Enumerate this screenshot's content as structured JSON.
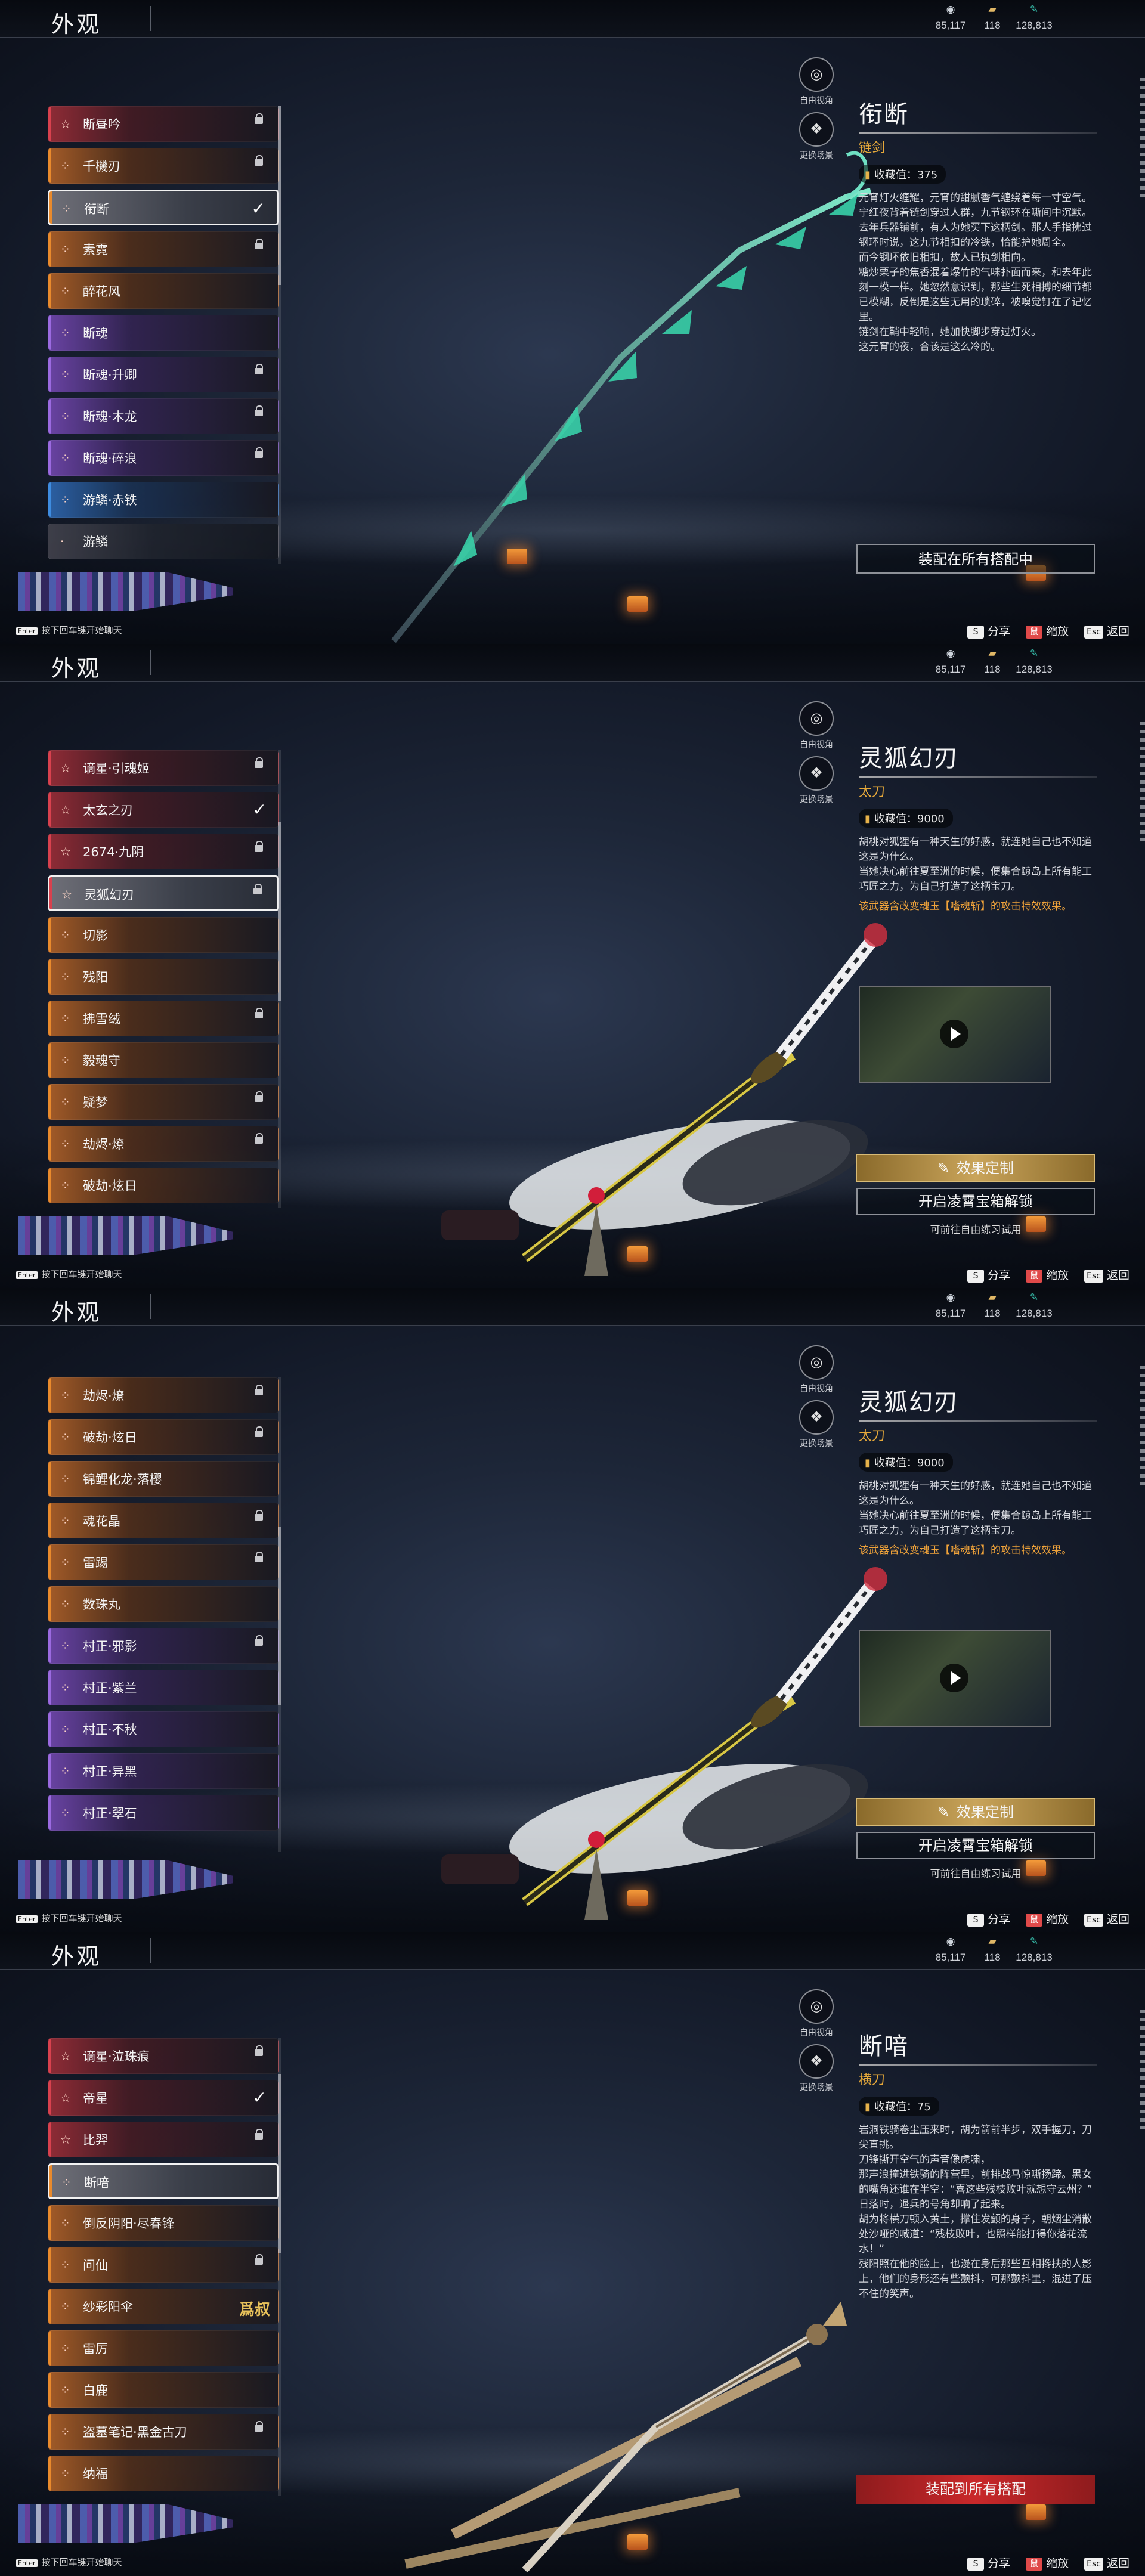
{
  "screens": [
    {
      "title": "外观",
      "currencies": [
        {
          "icon": "coin-icon",
          "value": "85,117"
        },
        {
          "icon": "ticket-icon",
          "value": "118"
        },
        {
          "icon": "jade-feather-icon",
          "value": "128,813"
        }
      ],
      "right_buttons": [
        {
          "icon": "camera-icon",
          "label": "自由视角"
        },
        {
          "icon": "scene-icon",
          "label": "更换场景"
        }
      ],
      "list": [
        {
          "label": "断昼吟",
          "rarity": "red",
          "state": "lock"
        },
        {
          "label": "千機刃",
          "rarity": "orange",
          "state": "lock"
        },
        {
          "label": "衔断",
          "rarity": "orange",
          "state": "check",
          "selected": true
        },
        {
          "label": "素霓",
          "rarity": "orange",
          "state": "lock"
        },
        {
          "label": "醉花风",
          "rarity": "orange",
          "state": ""
        },
        {
          "label": "断魂",
          "rarity": "purple",
          "state": ""
        },
        {
          "label": "断魂·升卿",
          "rarity": "purple",
          "state": "lock"
        },
        {
          "label": "断魂·木龙",
          "rarity": "purple",
          "state": "lock"
        },
        {
          "label": "断魂·碎浪",
          "rarity": "purple",
          "state": "lock"
        },
        {
          "label": "游鳞·赤铁",
          "rarity": "blue",
          "state": ""
        },
        {
          "label": "游鳞",
          "rarity": "plain",
          "state": ""
        }
      ],
      "detail": {
        "name": "衔断",
        "type": "链剑",
        "collection": "收藏值：375",
        "description": "元宵灯火缠耀，元宵的甜腻香气缠绕着每一寸空气。宁红夜背着链剑穿过人群，九节钢环在嘶间中沉默。\n去年兵器铺前，有人为她买下这柄剑。那人手指拂过钢环时说，这九节相扣的冷铁，恰能护她周全。\n而今钢环依旧相扣，故人已执剑相向。\n糖炒栗子的焦香混着爆竹的气味扑面而来，和去年此刻一模一样。她忽然意识到，那些生死相搏的细节都已模糊，反倒是这些无用的琐碎，被嗅觉钉在了记忆里。\n链剑在鞘中轻响，她加快脚步穿过灯火。\n这元宵的夜，合该是这么冷的。",
        "note": "",
        "buttons": [
          {
            "label": "装配在所有搭配中",
            "style": "outline"
          }
        ],
        "hint": ""
      },
      "bottom": {
        "enter_key": "Enter",
        "enter_text": "按下回车键开始聊天",
        "share_key": "S",
        "share": "分享",
        "zoom_key": "鼠",
        "zoom": "缩放",
        "back_key": "Esc",
        "back": "返回"
      }
    },
    {
      "title": "外观",
      "currencies": [
        {
          "icon": "coin-icon",
          "value": "85,117"
        },
        {
          "icon": "ticket-icon",
          "value": "118"
        },
        {
          "icon": "jade-feather-icon",
          "value": "128,813"
        }
      ],
      "right_buttons": [
        {
          "icon": "camera-icon",
          "label": "自由视角"
        },
        {
          "icon": "scene-icon",
          "label": "更换场景"
        }
      ],
      "list": [
        {
          "label": "谪星·引魂姬",
          "rarity": "red",
          "state": "lock"
        },
        {
          "label": "太玄之刃",
          "rarity": "red",
          "state": "check"
        },
        {
          "label": "2674·九阴",
          "rarity": "red",
          "state": "lock"
        },
        {
          "label": "灵狐幻刃",
          "rarity": "red",
          "state": "lock",
          "selected": true
        },
        {
          "label": "切影",
          "rarity": "orange",
          "state": ""
        },
        {
          "label": "残阳",
          "rarity": "orange",
          "state": ""
        },
        {
          "label": "拂雪绒",
          "rarity": "orange",
          "state": "lock"
        },
        {
          "label": "毅魂守",
          "rarity": "orange",
          "state": ""
        },
        {
          "label": "疑梦",
          "rarity": "orange",
          "state": "lock"
        },
        {
          "label": "劫烬·燎",
          "rarity": "orange",
          "state": "lock"
        },
        {
          "label": "破劫·炫日",
          "rarity": "orange",
          "state": ""
        }
      ],
      "detail": {
        "name": "灵狐幻刃",
        "type": "太刀",
        "collection": "收藏值：9000",
        "description": "胡桃对狐狸有一种天生的好感，就连她自己也不知道这是为什么。\n当她决心前往夏至洲的时候，便集合鲸岛上所有能工巧匠之力，为自己打造了这柄宝刀。",
        "note": "该武器含改变魂玉【嗜魂斩】的攻击特效效果。",
        "buttons": [
          {
            "label": "效果定制",
            "style": "gold",
            "icon": "wrench-icon"
          },
          {
            "label": "开启凌霄宝箱解锁",
            "style": "outline"
          }
        ],
        "hint": "可前往自由练习试用"
      },
      "bottom": {
        "enter_key": "Enter",
        "enter_text": "按下回车键开始聊天",
        "share_key": "S",
        "share": "分享",
        "zoom_key": "鼠",
        "zoom": "缩放",
        "back_key": "Esc",
        "back": "返回"
      }
    },
    {
      "title": "外观",
      "currencies": [
        {
          "icon": "coin-icon",
          "value": "85,117"
        },
        {
          "icon": "ticket-icon",
          "value": "118"
        },
        {
          "icon": "jade-feather-icon",
          "value": "128,813"
        }
      ],
      "right_buttons": [
        {
          "icon": "camera-icon",
          "label": "自由视角"
        },
        {
          "icon": "scene-icon",
          "label": "更换场景"
        }
      ],
      "list": [
        {
          "label": "劫烬·燎",
          "rarity": "orange",
          "state": "lock"
        },
        {
          "label": "破劫·炫日",
          "rarity": "orange",
          "state": "lock"
        },
        {
          "label": "锦鲤化龙·落樱",
          "rarity": "orange",
          "state": ""
        },
        {
          "label": "魂花晶",
          "rarity": "orange",
          "state": "lock"
        },
        {
          "label": "雷踢",
          "rarity": "orange",
          "state": "lock"
        },
        {
          "label": "数珠丸",
          "rarity": "orange",
          "state": ""
        },
        {
          "label": "村正·邪影",
          "rarity": "purple",
          "state": "lock"
        },
        {
          "label": "村正·紫兰",
          "rarity": "purple",
          "state": ""
        },
        {
          "label": "村正·不秋",
          "rarity": "purple",
          "state": ""
        },
        {
          "label": "村正·异黑",
          "rarity": "purple",
          "state": ""
        },
        {
          "label": "村正·翠石",
          "rarity": "purple",
          "state": ""
        }
      ],
      "detail": {
        "name": "灵狐幻刃",
        "type": "太刀",
        "collection": "收藏值：9000",
        "description": "胡桃对狐狸有一种天生的好感，就连她自己也不知道这是为什么。\n当她决心前往夏至洲的时候，便集合鲸岛上所有能工巧匠之力，为自己打造了这柄宝刀。",
        "note": "该武器含改变魂玉【嗜魂斩】的攻击特效效果。",
        "buttons": [
          {
            "label": "效果定制",
            "style": "gold",
            "icon": "wrench-icon"
          },
          {
            "label": "开启凌霄宝箱解锁",
            "style": "outline"
          }
        ],
        "hint": "可前往自由练习试用"
      },
      "bottom": {
        "enter_key": "Enter",
        "enter_text": "按下回车键开始聊天",
        "share_key": "S",
        "share": "分享",
        "zoom_key": "鼠",
        "zoom": "缩放",
        "back_key": "Esc",
        "back": "返回"
      }
    },
    {
      "title": "外观",
      "currencies": [
        {
          "icon": "coin-icon",
          "value": "85,117"
        },
        {
          "icon": "ticket-icon",
          "value": "118"
        },
        {
          "icon": "jade-feather-icon",
          "value": "128,813"
        }
      ],
      "right_buttons": [
        {
          "icon": "camera-icon",
          "label": "自由视角"
        },
        {
          "icon": "scene-icon",
          "label": "更换场景"
        }
      ],
      "list": [
        {
          "label": "谪星·泣珠痕",
          "rarity": "red",
          "state": "lock"
        },
        {
          "label": "帝星",
          "rarity": "red",
          "state": "check"
        },
        {
          "label": "比羿",
          "rarity": "red",
          "state": "lock"
        },
        {
          "label": "断喑",
          "rarity": "orange",
          "state": "",
          "selected": true
        },
        {
          "label": "倒反阴阳·尽春锋",
          "rarity": "orange",
          "state": ""
        },
        {
          "label": "问仙",
          "rarity": "orange",
          "state": "lock"
        },
        {
          "label": "纱彩阳伞",
          "rarity": "orange",
          "state": "hot",
          "tag": "爲叔"
        },
        {
          "label": "雷厉",
          "rarity": "orange",
          "state": ""
        },
        {
          "label": "白鹿",
          "rarity": "orange",
          "state": ""
        },
        {
          "label": "盗墓笔记·黑金古刀",
          "rarity": "orange",
          "state": "lock"
        },
        {
          "label": "纳福",
          "rarity": "orange",
          "state": ""
        }
      ],
      "detail": {
        "name": "断喑",
        "type": "横刀",
        "collection": "收藏值：75",
        "description": "岩洞铁骑卷尘压来时，胡为箭前半步，双手握刀，刀尖直挑。\n刀锋撕开空气的声音像虎啸，\n那声浪撞进铁骑的阵营里，前排战马惊嘶扬蹄。黑女的嘴角还谁在半空：“喜这些残枝败叶就想守云州？”\n日落时，退兵的号角却响了起来。\n胡为将横刀顿入黄土，撑住发颤的身子，朝烟尘消散处沙哑的喊道：“残枝败叶，也照样能打得你落花流水！”\n残阳照在他的脸上，也漫在身后那些互相搀扶的人影上，他们的身形还有些颤抖，可那颤抖里，混进了压不住的笑声。",
        "note": "",
        "buttons": [
          {
            "label": "装配到所有搭配",
            "style": "red"
          }
        ],
        "hint": ""
      },
      "bottom": {
        "enter_key": "Enter",
        "enter_text": "按下回车键开始聊天",
        "share_key": "S",
        "share": "分享",
        "zoom_key": "鼠",
        "zoom": "缩放",
        "back_key": "Esc",
        "back": "返回"
      }
    }
  ]
}
